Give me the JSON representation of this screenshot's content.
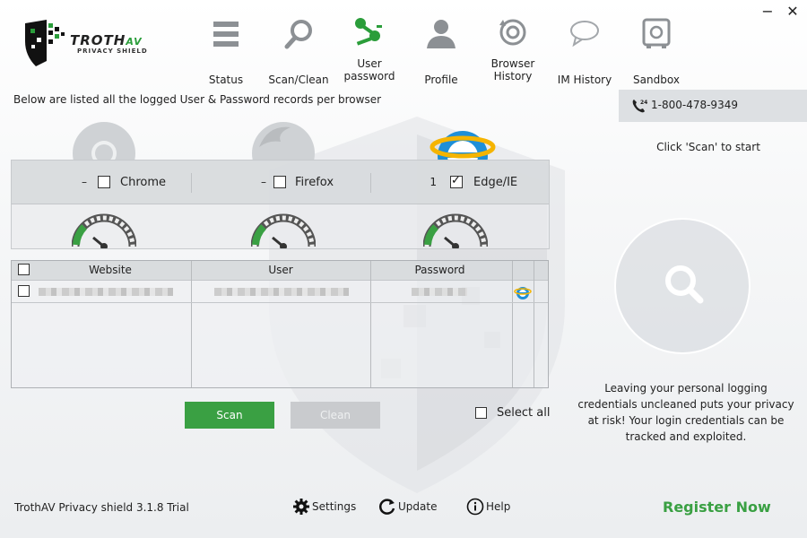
{
  "app": {
    "brand_name": "TROTH",
    "brand_suffix": "AV",
    "brand_tagline": "PRIVACY SHIELD",
    "version": "TrothAV Privacy shield 3.1.8 Trial"
  },
  "window_controls": {
    "minimize": "−",
    "close": "✕"
  },
  "nav": [
    {
      "label": "Status",
      "icon": "menu-icon"
    },
    {
      "label": "Scan/Clean",
      "icon": "search-icon"
    },
    {
      "label": "User password",
      "icon": "keys-icon",
      "active": true
    },
    {
      "label": "Profile",
      "icon": "user-icon"
    },
    {
      "label": "Browser History",
      "icon": "history-icon"
    },
    {
      "label": "IM History",
      "icon": "chat-icon"
    },
    {
      "label": "Sandbox",
      "icon": "safe-icon"
    }
  ],
  "description": "Below are listed all the logged User & Password records per browser",
  "browsers": [
    {
      "name": "Chrome",
      "count": "–",
      "checked": false
    },
    {
      "name": "Firefox",
      "count": "–",
      "checked": false
    },
    {
      "name": "Edge/IE",
      "count": "1",
      "checked": true
    }
  ],
  "table": {
    "columns": [
      "Website",
      "User",
      "Password"
    ]
  },
  "buttons": {
    "scan": "Scan",
    "clean": "Clean",
    "select_all": "Select all"
  },
  "right_panel": {
    "phone": "1-800-478-9349",
    "hint": "Click 'Scan' to start",
    "warning": "Leaving your personal logging credentials uncleaned puts your privacy at risk! Your login credentials can be tracked and exploited."
  },
  "footer": {
    "settings": "Settings",
    "update": "Update",
    "help": "Help",
    "register": "Register Now"
  },
  "colors": {
    "accent_green": "#3aa043",
    "panel_gray": "#d6d9dc",
    "disabled_gray": "#c9cbce"
  }
}
